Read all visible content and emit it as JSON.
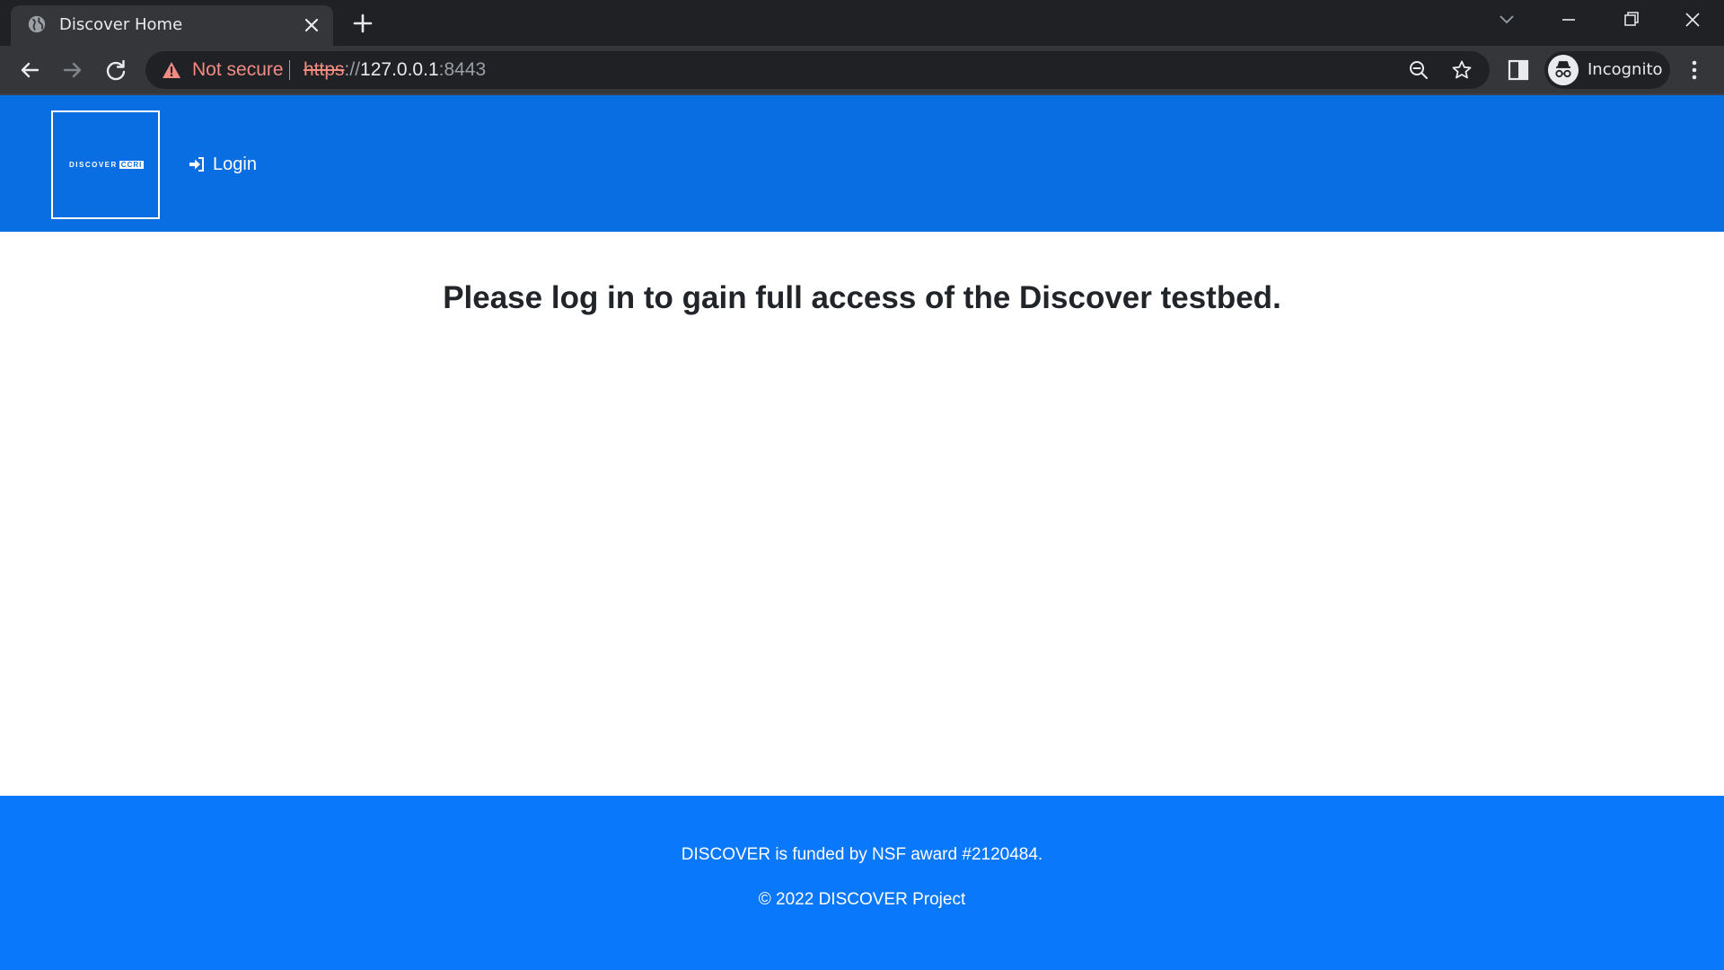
{
  "browser": {
    "tab": {
      "title": "Discover Home"
    },
    "address_bar": {
      "security_label": "Not secure",
      "url_scheme": "https",
      "url_separator": "://",
      "url_host": "127.0.0.1",
      "url_port": ":8443"
    },
    "profile": {
      "label": "Incognito"
    }
  },
  "header": {
    "logo": {
      "text": "DISCOVER",
      "tag": "CCRI"
    },
    "nav": {
      "login_label": "Login"
    }
  },
  "main": {
    "headline": "Please log in to gain full access of the Discover testbed."
  },
  "footer": {
    "funding_prefix": "DISCOVER is funded by NSF award ",
    "award_number": "#2120484",
    "funding_suffix": ".",
    "copyright_prefix": "© 2022 ",
    "copyright_org": "DISCOVER",
    "copyright_suffix": " Project"
  },
  "colors": {
    "header_bg": "#0a6ee3",
    "footer_bg": "#0a78fa",
    "warning": "#f28b82"
  }
}
